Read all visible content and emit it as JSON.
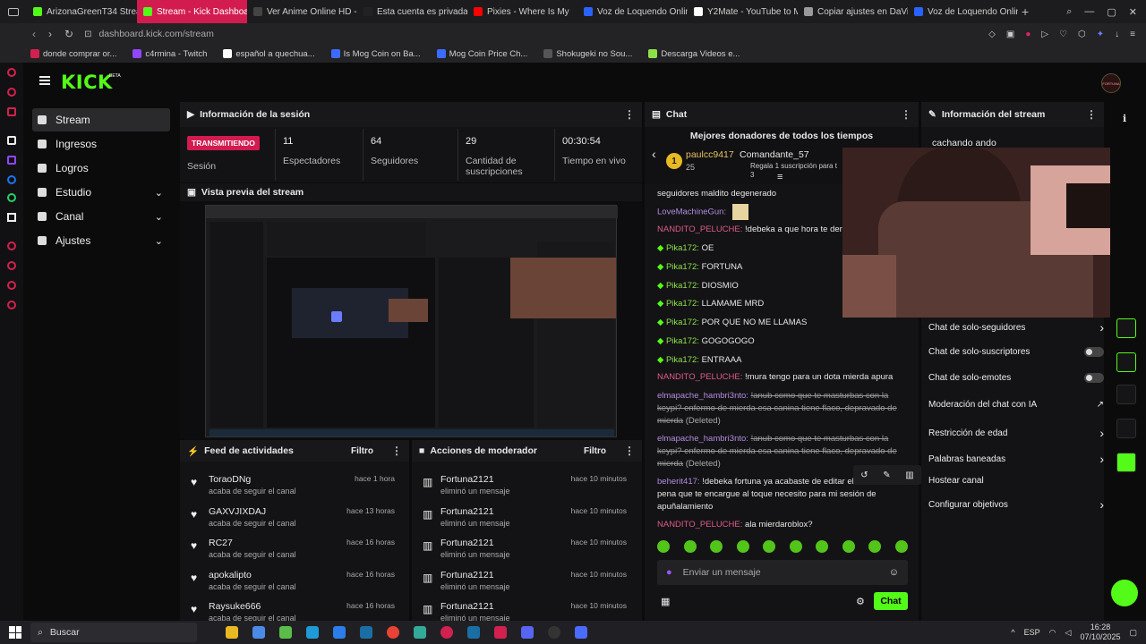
{
  "browser": {
    "tabs": [
      {
        "label": "ArizonaGreenT34 Strea",
        "color": "#53fc18",
        "active": false
      },
      {
        "label": "Stream - Kick Dashboard",
        "color": "#53fc18",
        "active": true
      },
      {
        "label": "Ver Anime Online HD - ",
        "color": "#444444",
        "active": false
      },
      {
        "label": "Esta cuenta es privada.",
        "color": "#222222",
        "active": false
      },
      {
        "label": "Pixies - Where Is My",
        "color": "#ff0000",
        "active": false
      },
      {
        "label": "Voz de Loquendo Online",
        "color": "#2a62ff",
        "active": false
      },
      {
        "label": "Y2Mate - YouTube to M",
        "color": "#ffffff",
        "active": false
      },
      {
        "label": "Copiar ajustes en DaVin",
        "color": "#999999",
        "active": false
      },
      {
        "label": "Voz de Loquendo Online",
        "color": "#2a62ff",
        "active": false
      }
    ],
    "url": "dashboard.kick.com/stream",
    "bookmarks": [
      {
        "label": "donde comprar or...",
        "color": "#d2214e"
      },
      {
        "label": "c4rmina - Twitch",
        "color": "#9146ff"
      },
      {
        "label": "español a quechua...",
        "color": "#ffffff"
      },
      {
        "label": "Is Mog Coin on Ba...",
        "color": "#3b6cff"
      },
      {
        "label": "Mog Coin Price Ch...",
        "color": "#3b6cff"
      },
      {
        "label": "Shokugeki no Sou...",
        "color": "#555555"
      },
      {
        "label": "Descarga Videos e...",
        "color": "#8de04a"
      }
    ]
  },
  "app": {
    "logo": "KICK",
    "logo_badge": "BETA",
    "avatar_label": "FORTUNA",
    "accent": "#53fc18"
  },
  "sidenav": [
    {
      "label": "Stream",
      "icon": "camera-icon",
      "active": true,
      "expandable": false
    },
    {
      "label": "Ingresos",
      "icon": "chart-icon",
      "active": false,
      "expandable": false
    },
    {
      "label": "Logros",
      "icon": "trophy-icon",
      "active": false,
      "expandable": false
    },
    {
      "label": "Estudio",
      "icon": "studio-icon",
      "active": false,
      "expandable": true
    },
    {
      "label": "Canal",
      "icon": "channel-icon",
      "active": false,
      "expandable": true
    },
    {
      "label": "Ajustes",
      "icon": "gear-icon",
      "active": false,
      "expandable": true
    }
  ],
  "session": {
    "title": "Información de la sesión",
    "status_badge": "TRANSMITIENDO",
    "status_label": "Sesión",
    "stats": [
      {
        "value": "11",
        "label": "Espectadores"
      },
      {
        "value": "64",
        "label": "Seguidores"
      },
      {
        "value": "29",
        "label": "Cantidad de suscripciones"
      },
      {
        "value": "00:30:54",
        "label": "Tiempo en vivo"
      }
    ]
  },
  "preview": {
    "title": "Vista previa del stream"
  },
  "feed": {
    "title": "Feed de actividades",
    "filter_label": "Filtro",
    "items": [
      {
        "user": "ToraoDNg",
        "action": "acaba de seguir el canal",
        "time": "hace 1 hora"
      },
      {
        "user": "GAXVJIXDAJ",
        "action": "acaba de seguir el canal",
        "time": "hace 13 horas"
      },
      {
        "user": "RC27",
        "action": "acaba de seguir el canal",
        "time": "hace 16 horas"
      },
      {
        "user": "apokalipto",
        "action": "acaba de seguir el canal",
        "time": "hace 16 horas"
      },
      {
        "user": "Raysuke666",
        "action": "acaba de seguir el canal",
        "time": "hace 16 horas"
      }
    ]
  },
  "modactions": {
    "title": "Acciones de moderador",
    "filter_label": "Filtro",
    "items": [
      {
        "user": "Fortuna2121",
        "action": "eliminó un mensaje",
        "time": "hace 10 minutos"
      },
      {
        "user": "Fortuna2121",
        "action": "eliminó un mensaje",
        "time": "hace 10 minutos"
      },
      {
        "user": "Fortuna2121",
        "action": "eliminó un mensaje",
        "time": "hace 10 minutos"
      },
      {
        "user": "Fortuna2121",
        "action": "eliminó un mensaje",
        "time": "hace 10 minutos"
      },
      {
        "user": "Fortuna2121",
        "action": "eliminó un mensaje",
        "time": "hace 10 minutos"
      }
    ]
  },
  "chat": {
    "title": "Chat",
    "donors_title": "Mejores donadores de todos los tiempos",
    "donor1_name": "paulcc9417",
    "donor1_amount": "25",
    "donor2_name": "Comandante_57",
    "donor2_desc": "Regala 1 suscripción para t",
    "donor2_sub": "3",
    "input_placeholder": "Enviar un mensaje",
    "send_label": "Chat",
    "messages": [
      {
        "user": "",
        "text": "seguidores maldito degenerado",
        "style": "plain"
      },
      {
        "user": "LoveMachineGun:",
        "text": "",
        "style": "purple"
      },
      {
        "user": "NANDITO_PELUCHE:",
        "text": "!debeka a que hora te denies",
        "style": "pink"
      },
      {
        "user": "Pika172:",
        "text": "OE",
        "style": "green"
      },
      {
        "user": "Pika172:",
        "text": "FORTUNA",
        "style": "green"
      },
      {
        "user": "Pika172:",
        "text": "DIOSMIO",
        "style": "green"
      },
      {
        "user": "Pika172:",
        "text": "LLAMAME MRD",
        "style": "green"
      },
      {
        "user": "Pika172:",
        "text": "POR QUE NO ME LLAMAS",
        "style": "green"
      },
      {
        "user": "Pika172:",
        "text": "GOGOGOGO",
        "style": "green"
      },
      {
        "user": "Pika172:",
        "text": "ENTRAAA",
        "style": "green"
      },
      {
        "user": "NANDITO_PELUCHE:",
        "text": "!mura tengo para un dota mierda apura",
        "style": "pink"
      },
      {
        "user": "elmapache_hambri3nto:",
        "text": "!anub como que te masturbas con la keypi? enfermo de mierda esa canina tiene flaco, depravado de mierda",
        "deleted": "(Deleted)",
        "style": "purple-del"
      },
      {
        "user": "elmapache_hambri3nto:",
        "text": "!anub como que te masturbas con la keypi? enfermo de mierda esa canina tiene flaco, depravado de mierda",
        "deleted": "(Deleted)",
        "style": "purple-del"
      },
      {
        "user": "beherit417:",
        "text": "!debeka fortuna ya acabaste de editar el canal de pena que te encargue al toque necesito para mi sesión de apuñalamiento",
        "style": "purple"
      },
      {
        "user": "NANDITO_PELUCHE:",
        "text": "ala mierdaroblox?",
        "style": "pink"
      }
    ]
  },
  "streaminfo": {
    "title": "Información del stream",
    "stream_title": "cachando ando",
    "rows": [
      {
        "label": "Chat de solo-seguidores",
        "control": "chevron"
      },
      {
        "label": "Chat de solo-suscriptores",
        "control": "toggle"
      },
      {
        "label": "Chat de solo-emotes",
        "control": "toggle"
      },
      {
        "label": "Moderación del chat con IA",
        "control": "external"
      },
      {
        "label": "Restricción de edad",
        "control": "chevron"
      },
      {
        "label": "Palabras baneadas",
        "control": "chevron"
      },
      {
        "label": "Hostear canal",
        "control": "none"
      },
      {
        "label": "Configurar objetivos",
        "control": "chevron"
      }
    ]
  },
  "taskbar": {
    "search_label": "Buscar",
    "time": "16:28",
    "date": "07/10/2025",
    "lang": "ESP"
  }
}
